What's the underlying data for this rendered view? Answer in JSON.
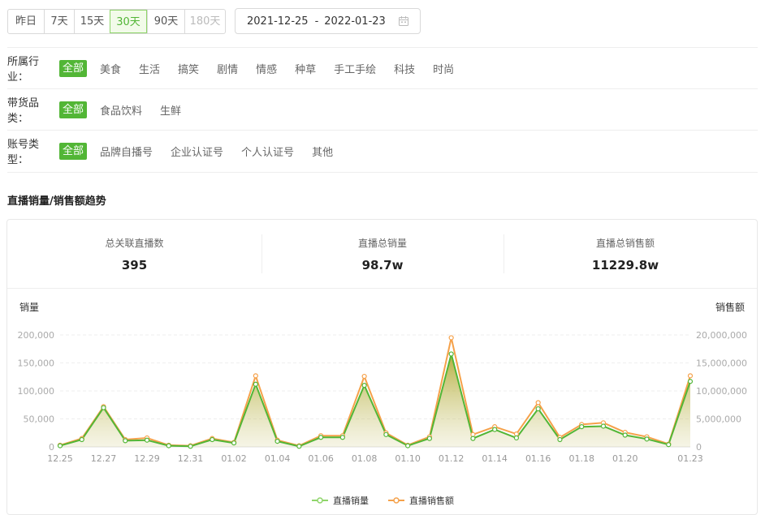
{
  "range_buttons": [
    {
      "label": "昨日",
      "state": "normal"
    },
    {
      "label": "7天",
      "state": "normal"
    },
    {
      "label": "15天",
      "state": "normal"
    },
    {
      "label": "30天",
      "state": "active"
    },
    {
      "label": "90天",
      "state": "normal"
    },
    {
      "label": "180天",
      "state": "disabled"
    }
  ],
  "date_range": {
    "start": "2021-12-25",
    "separator": "-",
    "end": "2022-01-23"
  },
  "filters": {
    "industry": {
      "label": "所属行业：",
      "options": [
        "全部",
        "美食",
        "生活",
        "搞笑",
        "剧情",
        "情感",
        "种草",
        "手工手绘",
        "科技",
        "时尚"
      ],
      "selected": 0
    },
    "category": {
      "label": "带货品类：",
      "options": [
        "全部",
        "食品饮料",
        "生鲜"
      ],
      "selected": 0
    },
    "account": {
      "label": "账号类型：",
      "options": [
        "全部",
        "品牌自播号",
        "企业认证号",
        "个人认证号",
        "其他"
      ],
      "selected": 0
    }
  },
  "section_title": "直播销量/销售额趋势",
  "stats": [
    {
      "label": "总关联直播数",
      "value": "395"
    },
    {
      "label": "直播总销量",
      "value": "98.7w"
    },
    {
      "label": "直播总销售额",
      "value": "11229.8w"
    }
  ],
  "colors": {
    "accent": "#52b636",
    "sales": "#52b636",
    "revenue": "#f5a14a"
  },
  "chart_data": {
    "type": "line",
    "ylabel": "销量",
    "ylabel_right": "销售额",
    "ylim": [
      0,
      200000
    ],
    "ylim_right": [
      0,
      20000000
    ],
    "y_ticks": [
      "0",
      "50,000",
      "100,000",
      "150,000",
      "200,000"
    ],
    "y_ticks_right": [
      "0",
      "5,000,000",
      "10,000,000",
      "15,000,000",
      "20,000,000"
    ],
    "x": [
      "12.25",
      "12.26",
      "12.27",
      "12.28",
      "12.29",
      "12.30",
      "12.31",
      "01.01",
      "01.02",
      "01.03",
      "01.04",
      "01.05",
      "01.06",
      "01.07",
      "01.08",
      "01.09",
      "01.10",
      "01.11",
      "01.12",
      "01.13",
      "01.14",
      "01.15",
      "01.16",
      "01.17",
      "01.18",
      "01.19",
      "01.20",
      "01.21",
      "01.22",
      "01.23"
    ],
    "x_tick_labels": [
      "12.25",
      "12.27",
      "12.29",
      "12.31",
      "01.02",
      "01.04",
      "01.06",
      "01.08",
      "01.10",
      "01.12",
      "01.14",
      "01.16",
      "01.18",
      "01.20",
      "01.23"
    ],
    "series": [
      {
        "name": "直播销量",
        "axis": "left",
        "values": [
          2000,
          13000,
          70000,
          11000,
          12000,
          2000,
          1000,
          13000,
          7000,
          112000,
          10000,
          1000,
          17000,
          17000,
          110000,
          22000,
          2000,
          15000,
          166000,
          15000,
          31000,
          16000,
          68000,
          13000,
          36000,
          37000,
          21000,
          14000,
          4000,
          117000
        ]
      },
      {
        "name": "直播销售额",
        "axis": "right",
        "values": [
          300000,
          1500000,
          7200000,
          1300000,
          1600000,
          300000,
          200000,
          1500000,
          800000,
          12700000,
          1200000,
          200000,
          2000000,
          2000000,
          12600000,
          2500000,
          300000,
          1800000,
          19500000,
          2200000,
          3600000,
          2300000,
          7900000,
          1700000,
          4000000,
          4300000,
          2600000,
          1800000,
          500000,
          12700000
        ]
      }
    ]
  }
}
